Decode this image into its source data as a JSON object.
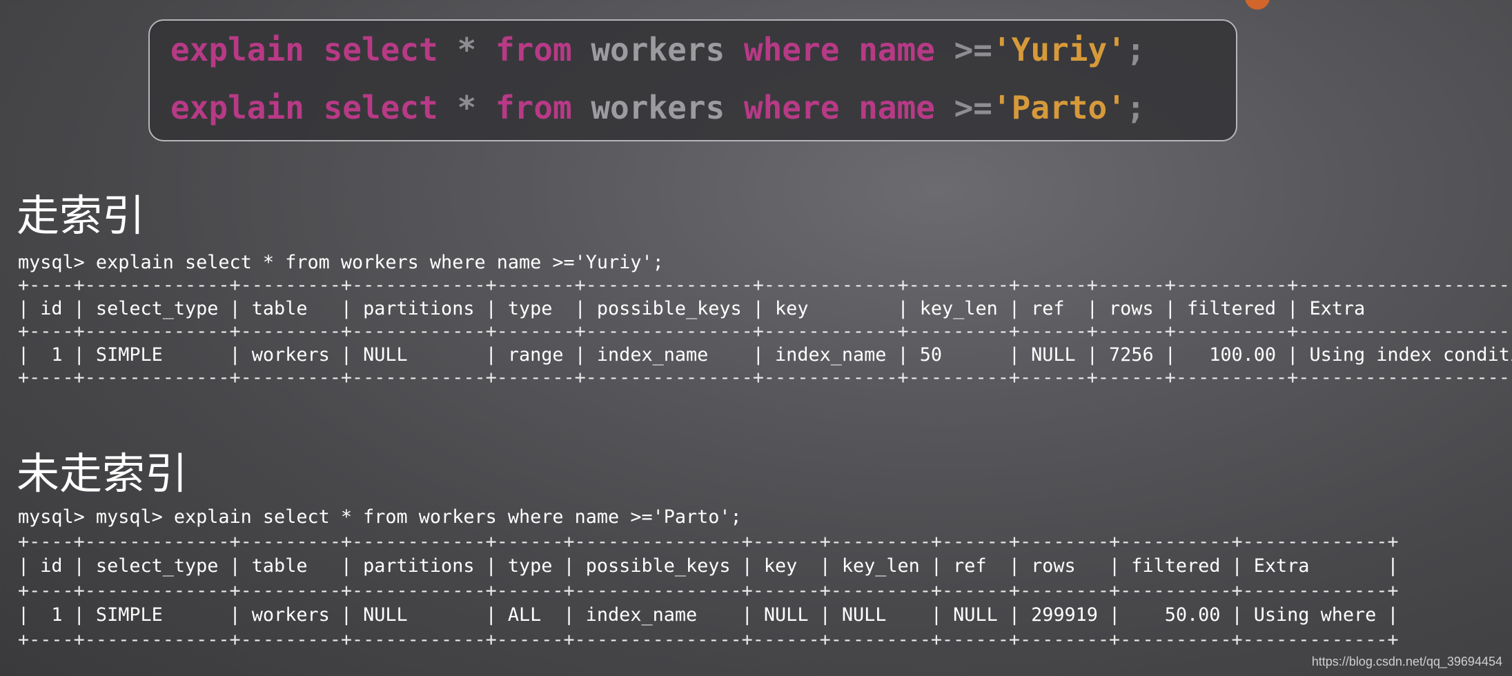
{
  "code_block": {
    "lines": [
      {
        "kw1": "explain",
        "kw2": "select",
        "star": "*",
        "kw3": "from",
        "table": "workers",
        "kw4": "where",
        "column": "name",
        "op": ">=",
        "value": "'Yuriy'",
        "end": ";"
      },
      {
        "kw1": "explain",
        "kw2": "select",
        "star": "*",
        "kw3": "from",
        "table": "workers",
        "kw4": "where",
        "column": "name",
        "op": ">=",
        "value": "'Parto'",
        "end": ";"
      }
    ]
  },
  "section_index": {
    "heading": "走索引",
    "prompt_line": "mysql> explain select * from workers where name >='Yuriy';",
    "border": "+----+-------------+---------+------------+-------+---------------+------------+---------+------+------+----------+-----------------------+",
    "header_row": "| id | select_type | table   | partitions | type  | possible_keys | key        | key_len | ref  | rows | filtered | Extra                 |",
    "data_row": "|  1 | SIMPLE      | workers | NULL       | range | index_name    | index_name | 50      | NULL | 7256 |   100.00 | Using index condition |"
  },
  "section_no_index": {
    "heading": "未走索引",
    "prompt_line": "mysql> mysql> explain select * from workers where name >='Parto';",
    "border": "+----+-------------+---------+------------+------+---------------+------+---------+------+--------+----------+-------------+",
    "header_row": "| id | select_type | table   | partitions | type | possible_keys | key  | key_len | ref  | rows   | filtered | Extra       |",
    "data_row": "|  1 | SIMPLE      | workers | NULL       | ALL  | index_name    | NULL | NULL    | NULL | 299919 |    50.00 | Using where |"
  },
  "watermark": "https://blog.csdn.net/qq_39694454",
  "colors": {
    "keyword": "#b83a86",
    "string": "#d79a3a",
    "identifier": "#9c9ca0",
    "accent_dot": "#d2652c"
  }
}
